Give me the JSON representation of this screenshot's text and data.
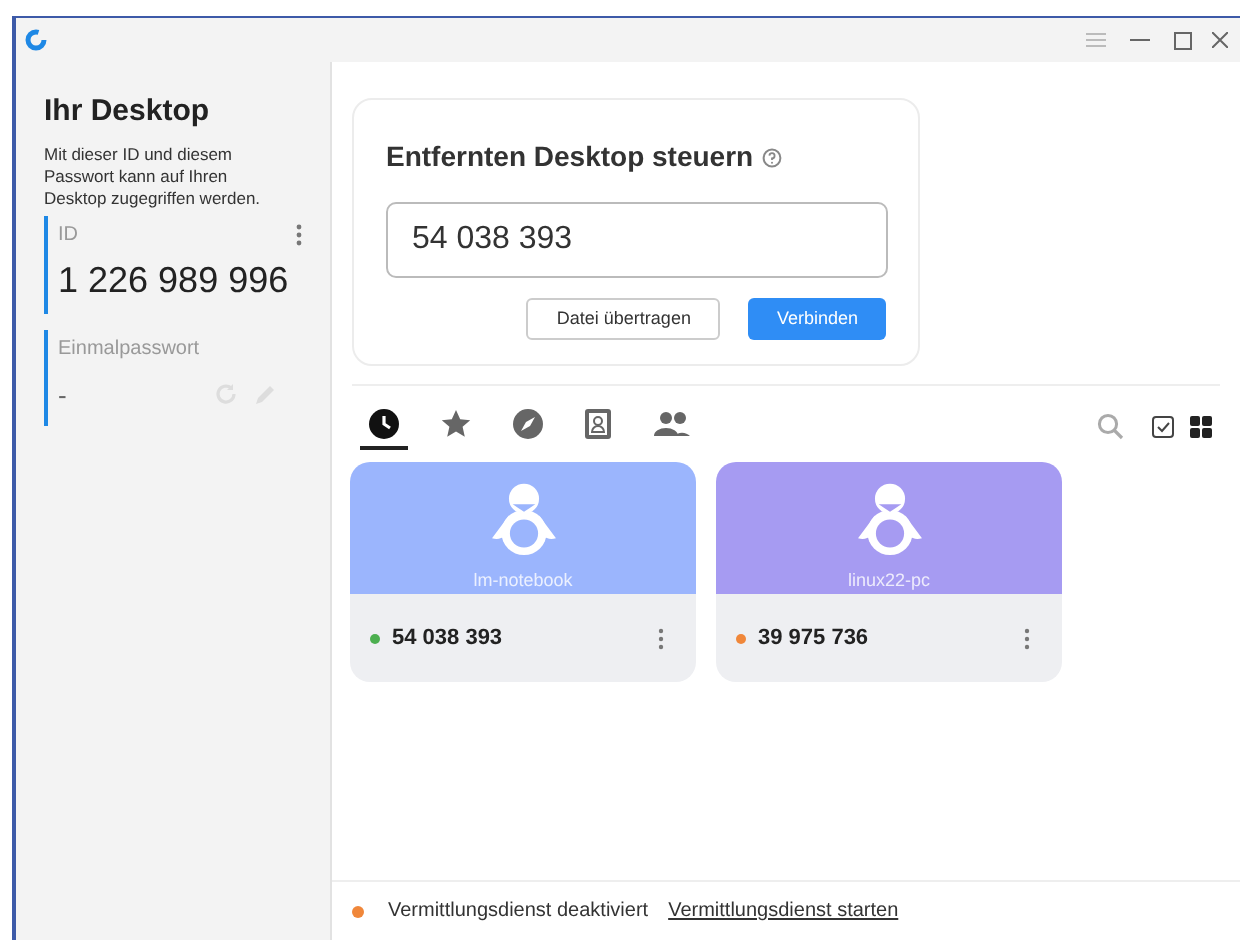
{
  "sidebar": {
    "title": "Ihr Desktop",
    "description": "Mit dieser ID und diesem Passwort kann auf Ihren Desktop zugegriffen werden.",
    "id_label": "ID",
    "id_value": "1 226 989 996",
    "password_label": "Einmalpasswort",
    "password_value": "-"
  },
  "connect_card": {
    "title": "Entfernten Desktop steuern",
    "input_value": "54 038 393",
    "buttons": [
      {
        "label": "Datei übertragen",
        "kind": "secondary"
      },
      {
        "label": "Verbinden",
        "kind": "primary"
      }
    ]
  },
  "tabs": [
    {
      "kind": "recent",
      "selected": true
    },
    {
      "kind": "favorites",
      "selected": false
    },
    {
      "kind": "discovered",
      "selected": false
    },
    {
      "kind": "addressbook",
      "selected": false
    },
    {
      "kind": "group",
      "selected": false
    }
  ],
  "peers": [
    {
      "hostname": "lm-notebook",
      "id": "54 038 393",
      "thumbnail": {
        "color": "#9bb5fd"
      },
      "status": {
        "color": "#4caf50"
      }
    },
    {
      "hostname": "linux22-pc",
      "id": "39 975 736",
      "thumbnail": {
        "color": "#a69bf2"
      },
      "status": {
        "color": "#f0873a"
      }
    }
  ],
  "status_bar": {
    "status": {
      "color": "#f0873a"
    },
    "message": "Vermittlungsdienst deaktiviert",
    "link": "Vermittlungsdienst starten"
  }
}
